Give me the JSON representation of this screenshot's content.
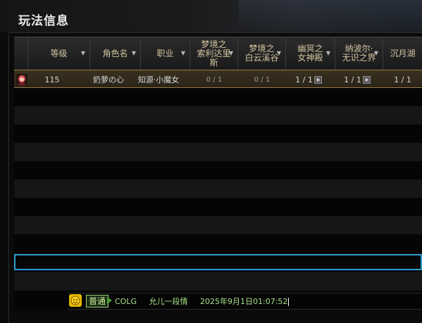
{
  "window": {
    "title": "玩法信息"
  },
  "columns": [
    {
      "label": ""
    },
    {
      "label": "等级"
    },
    {
      "label": "角色名"
    },
    {
      "label": "职业"
    },
    {
      "label": "梦境之\n索利达里\n斯"
    },
    {
      "label": "梦境之\n白云溪谷"
    },
    {
      "label": "幽冥之\n女神殿"
    },
    {
      "label": "纳波尔·\n无识之界"
    },
    {
      "label": "沉月湖"
    }
  ],
  "rows": [
    {
      "level": "115",
      "name": "奶萝の心",
      "job": "知源·小魔女",
      "c1": "0 / 1",
      "c2": "0 / 1",
      "c3": "1 / 1",
      "c4": "1 / 1",
      "c5": "1 / 1"
    }
  ],
  "chat": {
    "channel": "普通",
    "server": "COLG",
    "user": "允儿一段情",
    "timestamp": "2025年9月1日01:07:52"
  },
  "colors": {
    "accent": "#2aa0d0",
    "header_text": "#d2c4a0",
    "chat_text": "#a8e08a"
  }
}
